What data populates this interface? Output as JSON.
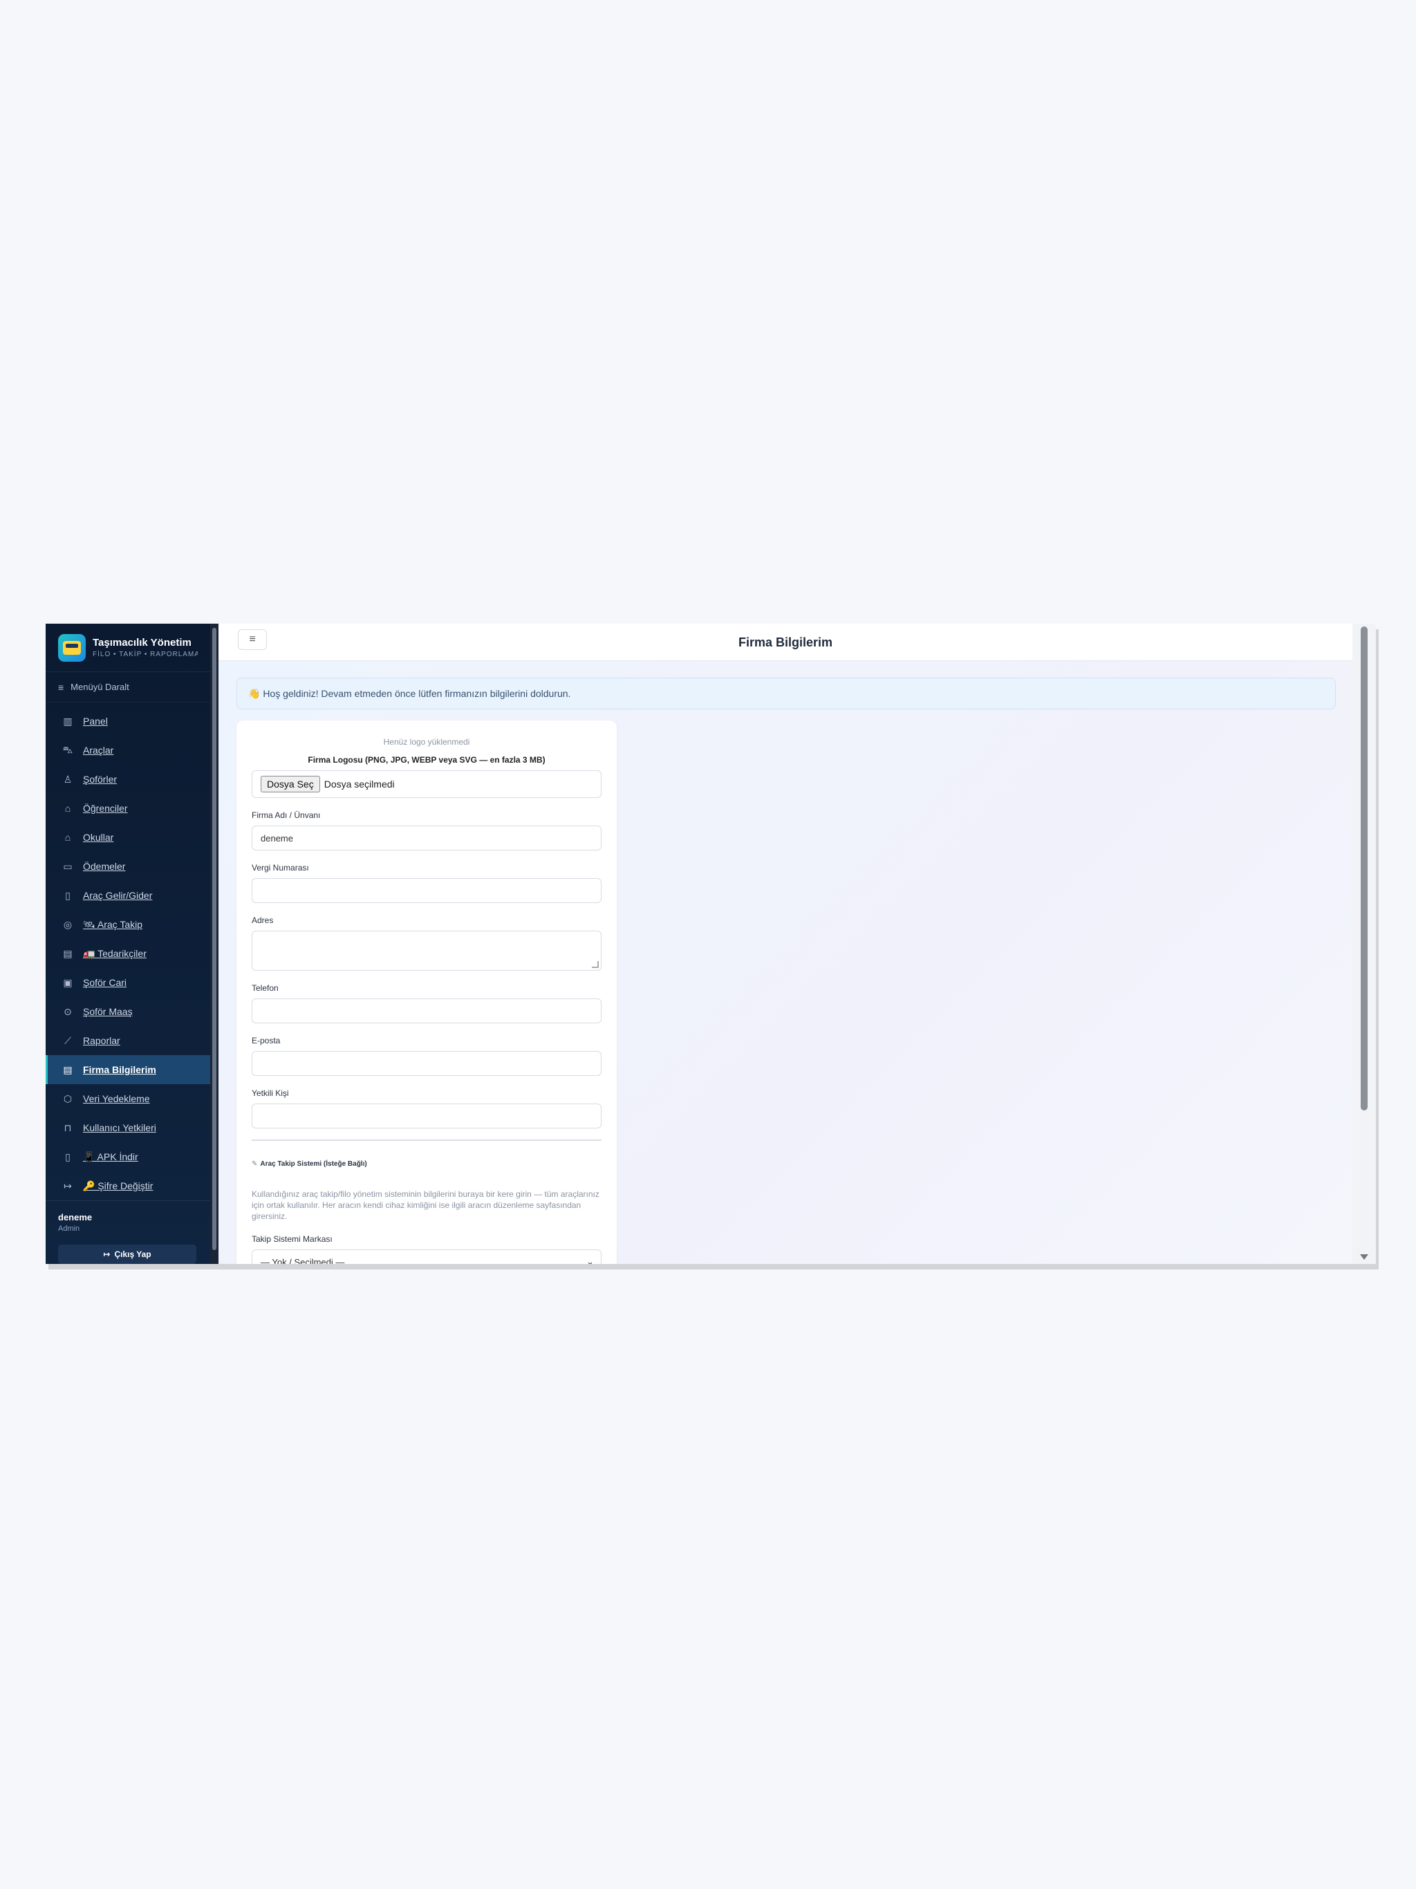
{
  "brand": {
    "title": "Taşımacılık Yönetim",
    "subtitle": "FİLO • TAKİP • RAPORLAMA"
  },
  "sidebar": {
    "collapse_label": "Menüyü Daralt",
    "items": [
      {
        "label": "Panel",
        "icon": "bar-chart-icon"
      },
      {
        "label": "Araçlar",
        "icon": "car-icon"
      },
      {
        "label": "Şoförler",
        "icon": "user-icon"
      },
      {
        "label": "Öğrenciler",
        "icon": "graduation-cap-icon"
      },
      {
        "label": "Okullar",
        "icon": "school-icon"
      },
      {
        "label": "Ödemeler",
        "icon": "credit-card-icon"
      },
      {
        "label": "Araç Gelir/Gider",
        "icon": "receipt-icon"
      },
      {
        "label": "🛰 Araç Takip",
        "icon": "map-pin-icon"
      },
      {
        "label": "🚛 Tedarikçiler",
        "icon": "building-icon"
      },
      {
        "label": "Şoför Cari",
        "icon": "ledger-icon"
      },
      {
        "label": "Şoför Maaş",
        "icon": "money-icon"
      },
      {
        "label": "Raporlar",
        "icon": "line-chart-icon"
      },
      {
        "label": "Firma Bilgilerim",
        "icon": "building-icon",
        "active": true
      },
      {
        "label": "Veri Yedekleme",
        "icon": "box-icon"
      },
      {
        "label": "Kullanıcı Yetkileri",
        "icon": "lock-icon"
      },
      {
        "label": "📱 APK İndir",
        "icon": "phone-icon"
      },
      {
        "label": "🔑 Şifre Değiştir",
        "icon": "logout-icon"
      }
    ]
  },
  "user": {
    "name": "deneme",
    "role": "Admin",
    "logout_label": "Çıkış Yap"
  },
  "header": {
    "title": "Firma Bilgilerim"
  },
  "alert": {
    "text": "👋 Hoş geldiniz! Devam etmeden önce lütfen firmanızın bilgilerini doldurun."
  },
  "form": {
    "logo_empty": "Henüz logo yüklenmedi",
    "logo_label": "Firma Logosu (PNG, JPG, WEBP veya SVG — en fazla 3 MB)",
    "file_button": "Dosya Seç",
    "file_status": "Dosya seçilmedi",
    "company_name_label": "Firma Adı / Ünvanı",
    "company_name_value": "deneme",
    "tax_label": "Vergi Numarası",
    "tax_value": "",
    "address_label": "Adres",
    "phone_label": "Telefon",
    "email_label": "E-posta",
    "contact_label": "Yetkili Kişi",
    "tracking_section_title": "Araç Takip Sistemi (İsteğe Bağlı)",
    "tracking_section_desc": "Kullandığınız araç takip/filo yönetim sisteminin bilgilerini buraya bir kere girin — tüm araçlarınız için ortak kullanılır. Her aracın kendi cihaz kimliğini ise ilgili aracın düzenleme sayfasından girersiniz.",
    "tracking_brand_label": "Takip Sistemi Markası",
    "tracking_brand_value": "— Yok / Seçilmedi —"
  }
}
